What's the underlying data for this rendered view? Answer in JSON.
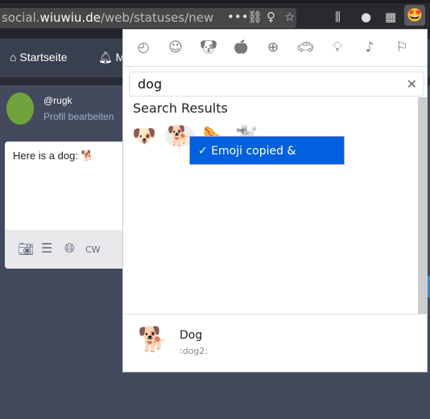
{
  "browser": {
    "url_prefix": "social.",
    "url_domain": "wiuwiu.de",
    "url_path": "/web/statuses/new",
    "icons": [
      "more-icon",
      "link-icon",
      "lightbulb-icon",
      "star-icon",
      "library-icon",
      "account-icon",
      "qr-code-icon",
      "emoji-extension-icon"
    ]
  },
  "nav": {
    "items": [
      {
        "label": "Startseite",
        "icon": "home-icon"
      },
      {
        "label": "M",
        "icon": "bell-icon"
      }
    ]
  },
  "profile": {
    "handle": "@rugk",
    "edit_link": "Profil bearbeiten"
  },
  "compose": {
    "text": "Here is a dog: 🐕",
    "cw_label": "CW"
  },
  "picker": {
    "categories": [
      "recent-icon",
      "smileys-icon",
      "animals-icon",
      "food-icon",
      "activity-icon",
      "travel-icon",
      "objects-icon",
      "symbols-icon",
      "flags-icon"
    ],
    "search_value": "dog",
    "results_heading": "Search Results",
    "results": [
      "🐶",
      "🐕",
      "🌭",
      "🐩"
    ],
    "tooltip": "Emoji copied & inserted",
    "preview": {
      "emoji": "🐕",
      "name": "Dog",
      "shortcode": ":dog2:"
    }
  },
  "colors": {
    "accent": "#0060df",
    "page_bg": "#444a5e",
    "nav_bg": "#393f4f"
  }
}
